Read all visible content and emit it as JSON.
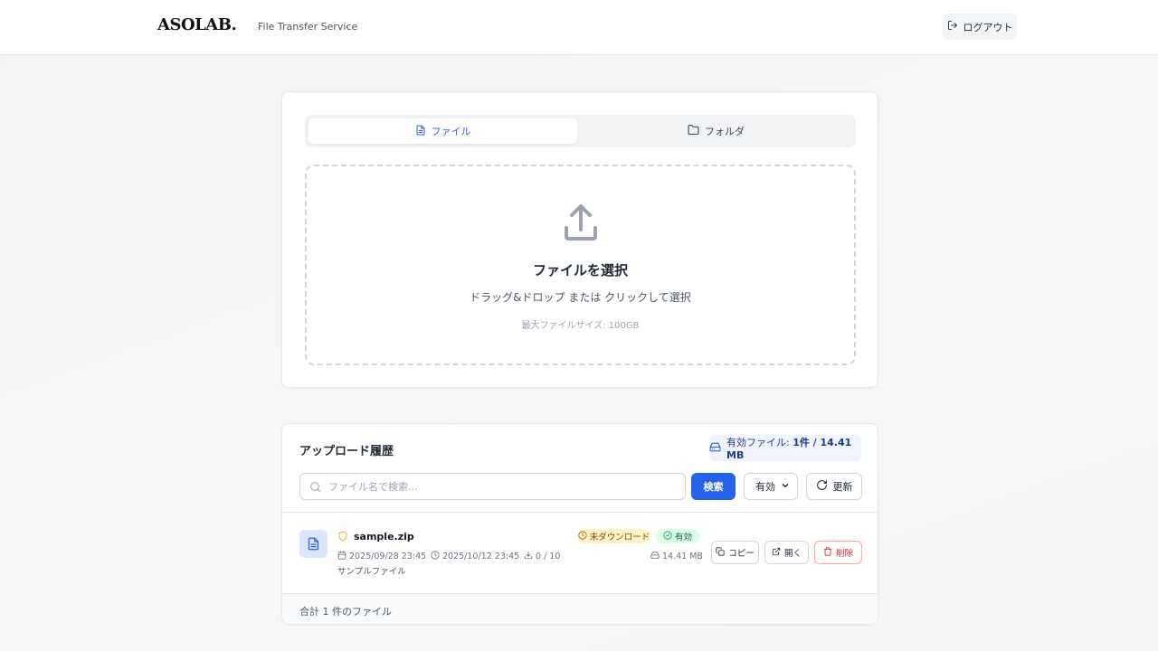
{
  "header": {
    "logo": "ASOLAB.",
    "subtitle": "File Transfer Service",
    "logout_label": "ログアウト"
  },
  "upload": {
    "tabs": [
      {
        "label": "ファイル",
        "icon": "file-icon",
        "active": true
      },
      {
        "label": "フォルダ",
        "icon": "folder-icon",
        "active": false
      }
    ],
    "dropzone": {
      "title": "ファイルを選択",
      "subtitle": "ドラッグ&ドロップ または クリックして選択",
      "max_size": "最大ファイルサイズ: 100GB"
    }
  },
  "history": {
    "title": "アップロード履歴",
    "stats_label": "有効ファイル: ",
    "stats_value": "1件 / 14.41 MB",
    "search_placeholder": "ファイル名で検索...",
    "search_button": "検索",
    "filter_selected": "有効",
    "refresh_label": "更新",
    "files": [
      {
        "name": "sample.zip",
        "uploaded": "2025/09/28 23:45",
        "expires": "2025/10/12 23:45",
        "downloads": "0 / 10",
        "description": "サンプルファイル",
        "status_download": "未ダウンロード",
        "status_active": "有効",
        "size": "14.41 MB",
        "actions": {
          "copy": "コピー",
          "open": "開く",
          "delete": "削除"
        }
      }
    ],
    "footer": "合計 1 件のファイル"
  },
  "colors": {
    "accent": "#2563eb",
    "pending_bg": "#fef3c7",
    "active_bg": "#dcfce7",
    "danger": "#dc2626"
  }
}
